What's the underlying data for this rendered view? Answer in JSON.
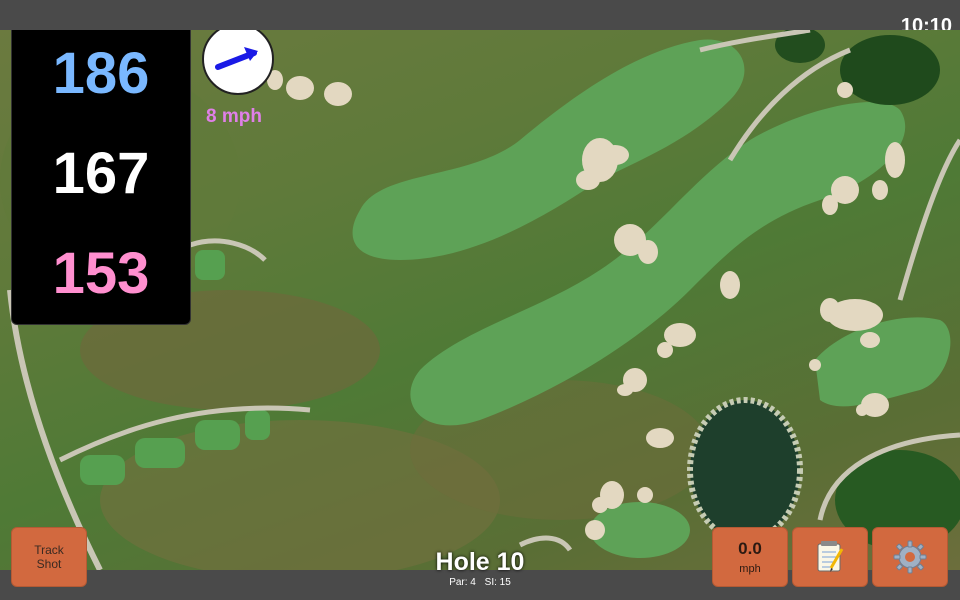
{
  "status_bar": {
    "time": "10:10"
  },
  "distances": {
    "back": "186",
    "middle": "167",
    "front": "153",
    "colors": {
      "back": "#7ab8ff",
      "middle": "#ffffff",
      "front": "#ff8fcf"
    }
  },
  "wind": {
    "speed_label": "8 mph",
    "arrow_icon": "arrow-right-up-icon",
    "arrow_color": "#1a1ae6"
  },
  "buttons": {
    "track_shot_line1": "Track",
    "track_shot_line2": "Shot",
    "wind_value": "0.0",
    "wind_unit": "mph",
    "notes_icon": "notepad-icon",
    "settings_icon": "gear-icon",
    "accent": "#d2693f"
  },
  "hole": {
    "title": "Hole 10",
    "par": "Par: 4",
    "si": "SI: 15"
  }
}
